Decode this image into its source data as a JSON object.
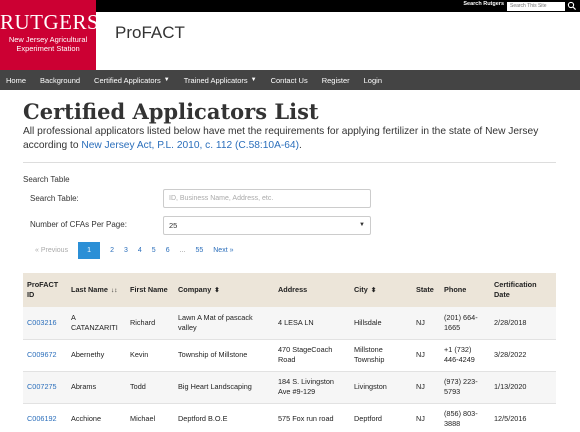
{
  "topbar": {
    "search_link": "Search Rutgers",
    "search_placeholder": "Search This Site"
  },
  "logo": {
    "brand": "RUTGERS",
    "sub_line1": "New Jersey Agricultural",
    "sub_line2": "Experiment Station"
  },
  "app_title": "ProFACT",
  "nav": [
    {
      "label": "Home",
      "dropdown": false
    },
    {
      "label": "Background",
      "dropdown": false
    },
    {
      "label": "Certified Applicators",
      "dropdown": true
    },
    {
      "label": "Trained Applicators",
      "dropdown": true
    },
    {
      "label": "Contact Us",
      "dropdown": false
    },
    {
      "label": "Register",
      "dropdown": false
    },
    {
      "label": "Login",
      "dropdown": false
    }
  ],
  "page": {
    "title": "Certified Applicators List",
    "intro_text": "All professional applicators listed below have met the requirements for applying fertilizer in the state of New Jersey according to ",
    "intro_link": "New Jersey Act, P.L. 2010, c. 112 (C.58:10A-64)",
    "intro_end": "."
  },
  "search": {
    "section_label": "Search Table",
    "search_label": "Search Table:",
    "search_placeholder": "ID, Business Name, Address, etc.",
    "perpage_label": "Number of CFAs Per Page:",
    "perpage_value": "25"
  },
  "pagination": {
    "previous": "« Previous",
    "pages": [
      "1",
      "2",
      "3",
      "4",
      "5",
      "6",
      "...",
      "55"
    ],
    "active": "1",
    "next": "Next »"
  },
  "table": {
    "headers": {
      "id": "ProFACT ID",
      "last": "Last Name",
      "first": "First Name",
      "company": "Company",
      "address": "Address",
      "city": "City",
      "state": "State",
      "phone": "Phone",
      "date": "Certification Date"
    },
    "rows": [
      {
        "id": "C003216",
        "last": "A CATANZARITI",
        "first": "Richard",
        "company": "Lawn A Mat of pascack valley",
        "address": "4 LESA LN",
        "city": "Hillsdale",
        "state": "NJ",
        "phone": "(201) 664-1665",
        "date": "2/28/2018"
      },
      {
        "id": "C009672",
        "last": "Abernethy",
        "first": "Kevin",
        "company": "Township of Millstone",
        "address": "470 StageCoach Road",
        "city": "Millstone Township",
        "state": "NJ",
        "phone": "+1 (732) 446-4249",
        "date": "3/28/2022"
      },
      {
        "id": "C007275",
        "last": "Abrams",
        "first": "Todd",
        "company": "Big Heart Landscaping",
        "address": "184 S. Livingston Ave #9-129",
        "city": "Livingston",
        "state": "NJ",
        "phone": "(973) 223-5793",
        "date": "1/13/2020"
      },
      {
        "id": "C006192",
        "last": "Acchione",
        "first": "Michael",
        "company": "Deptford B.O.E",
        "address": "575 Fox run road",
        "city": "Deptford",
        "state": "NJ",
        "phone": "(856) 803-3888",
        "date": "12/5/2016"
      }
    ]
  }
}
